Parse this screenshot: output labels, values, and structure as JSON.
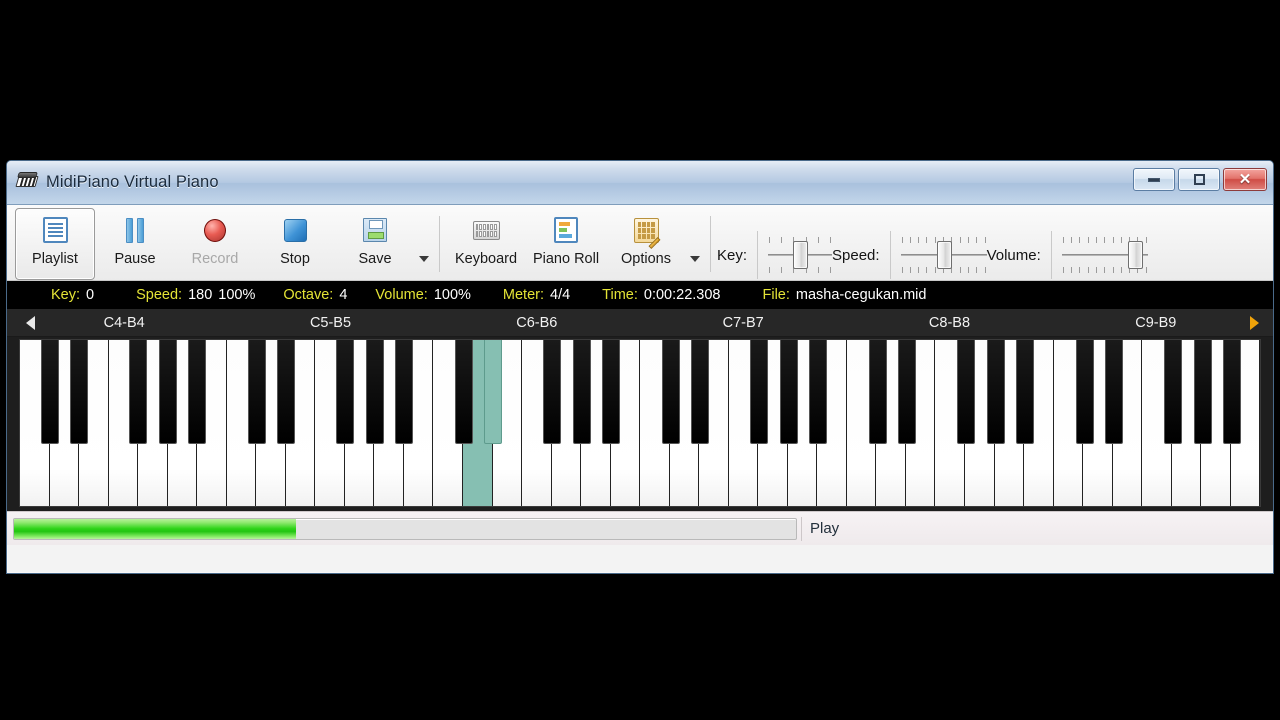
{
  "window": {
    "title": "MidiPiano Virtual Piano",
    "icon": "piano-icon",
    "controls": {
      "minimize": "–",
      "maximize": "□",
      "close": "✕"
    }
  },
  "toolbar": {
    "buttons": [
      {
        "label": "Playlist",
        "icon": "playlist-icon",
        "selected": true,
        "disabled": false
      },
      {
        "label": "Pause",
        "icon": "pause-icon",
        "selected": false,
        "disabled": false
      },
      {
        "label": "Record",
        "icon": "record-icon",
        "selected": false,
        "disabled": true
      },
      {
        "label": "Stop",
        "icon": "stop-icon",
        "selected": false,
        "disabled": false
      },
      {
        "label": "Save",
        "icon": "save-icon",
        "selected": false,
        "disabled": false
      },
      {
        "label": "Keyboard",
        "icon": "keyboard-icon",
        "selected": false,
        "disabled": false
      },
      {
        "label": "Piano Roll",
        "icon": "piano-roll-icon",
        "selected": false,
        "disabled": false
      },
      {
        "label": "Options",
        "icon": "options-icon",
        "selected": false,
        "disabled": false
      }
    ],
    "sliders": [
      {
        "label": "Key:",
        "position_pct": 50,
        "ticks": 6
      },
      {
        "label": "Speed:",
        "position_pct": 50,
        "ticks": 11
      },
      {
        "label": "Volume:",
        "position_pct": 100,
        "ticks": 11
      }
    ]
  },
  "status": {
    "items": [
      {
        "key": "Key:",
        "value": "0"
      },
      {
        "key": "Speed:",
        "value": "180",
        "value2": "100%"
      },
      {
        "key": "Octave:",
        "value": "4"
      },
      {
        "key": "Volume:",
        "value": "100%"
      },
      {
        "key": "Meter:",
        "value": "4/4"
      },
      {
        "key": "Time:",
        "value": "0:00:22.308"
      },
      {
        "key": "File:",
        "value": "masha-cegukan.mid"
      }
    ],
    "label_color": "#e4e436",
    "value_color": "#ffffff",
    "background": "#000000"
  },
  "octave_strip": {
    "scroll_left": "left-arrow-icon",
    "scroll_right": "right-arrow-icon",
    "right_arrow_color": "#f0a30a",
    "labels": [
      "C4-B4",
      "C5-B5",
      "C6-B6",
      "C7-B7",
      "C8-B8",
      "C9-B9"
    ]
  },
  "piano": {
    "octaves": 6,
    "white_keys_per_octave": 7,
    "white_key_count": 42,
    "black_pattern": [
      0,
      1,
      3,
      4,
      5
    ],
    "highlighted_white_key_index": 15,
    "highlighted_black_key": {
      "octave": 2,
      "index": 1
    },
    "highlight_color": "#86bfb2",
    "white_color": "#ffffff",
    "black_color": "#000000"
  },
  "bottom": {
    "progress_pct": 36,
    "progress_color": "#2fd419",
    "status_text": "Play"
  }
}
